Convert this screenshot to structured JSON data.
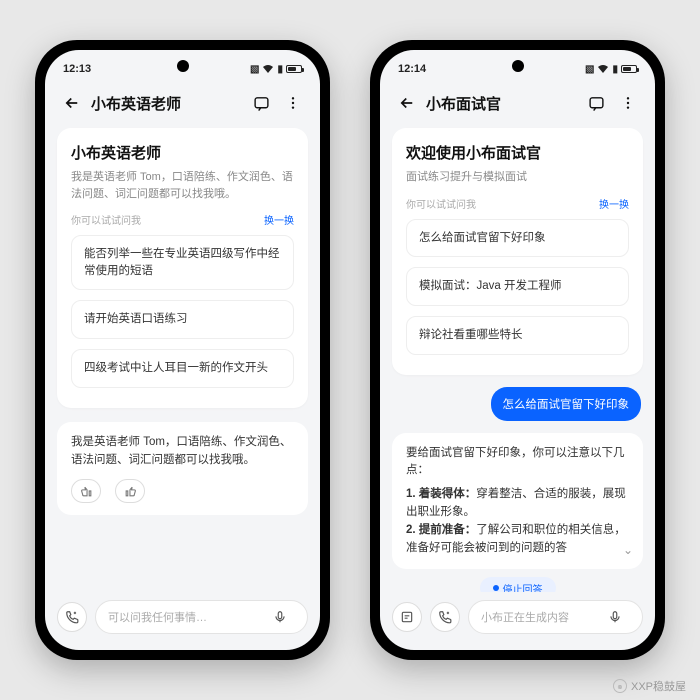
{
  "watermark": "XXP稳鼓屋",
  "phones": {
    "left": {
      "time": "12:13",
      "navTitle": "小布英语老师",
      "card": {
        "title": "小布英语老师",
        "sub": "我是英语老师 Tom，口语陪练、作文润色、语法问题、词汇问题都可以找我哦。",
        "hint": "你可以试试问我",
        "switch": "换一换"
      },
      "chips": [
        "能否列举一些在专业英语四级写作中经常使用的短语",
        "请开始英语口语练习",
        "四级考试中让人耳目一新的作文开头"
      ],
      "assistant": "我是英语老师 Tom，口语陪练、作文润色、语法问题、词汇问题都可以找我哦。",
      "input": {
        "placeholder": "可以问我任何事情…"
      }
    },
    "right": {
      "time": "12:14",
      "navTitle": "小布面试官",
      "card": {
        "title": "欢迎使用小布面试官",
        "sub": "面试练习提升与模拟面试",
        "hint": "你可以试试问我",
        "switch": "换一换"
      },
      "chips": [
        "怎么给面试官留下好印象",
        "模拟面试：Java 开发工程师",
        "辩论社看重哪些特长"
      ],
      "user": "怎么给面试官留下好印象",
      "answer": {
        "intro": "要给面试官留下好印象，你可以注意以下几点：",
        "p1_label": "1. 着装得体：",
        "p1_text": "穿着整洁、合适的服装，展现出职业形象。",
        "p2_label": "2. 提前准备：",
        "p2_text": "了解公司和职位的相关信息，准备好可能会被问到的问题的答"
      },
      "stop": "停止回答",
      "input": {
        "placeholder": "小布正在生成内容"
      }
    }
  }
}
